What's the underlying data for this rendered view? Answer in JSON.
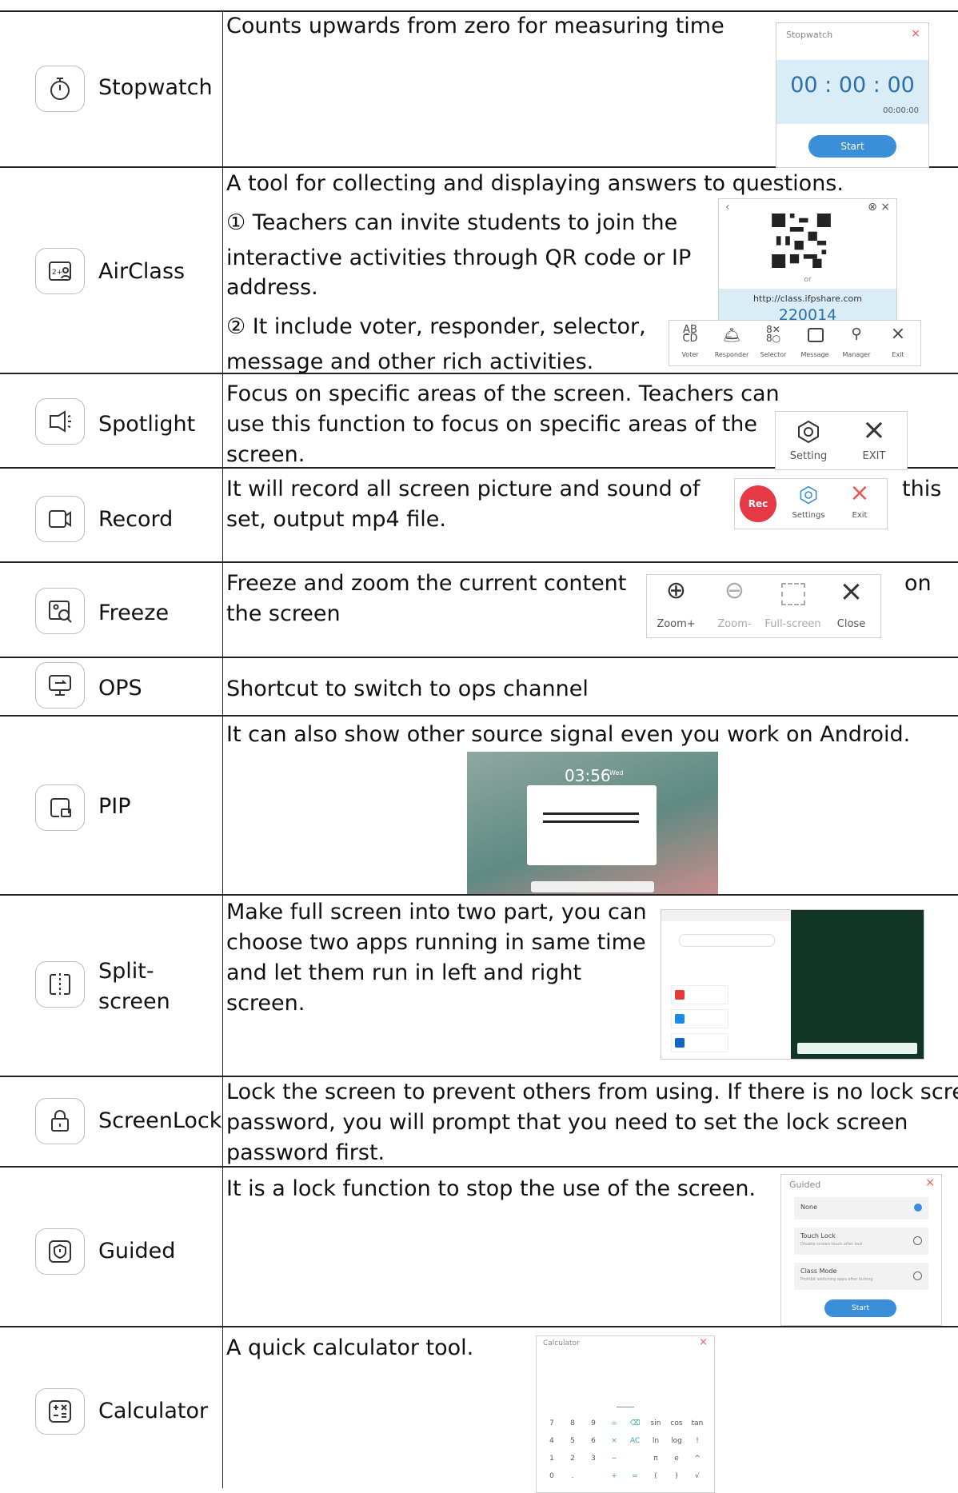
{
  "rows": [
    {
      "name": "Stopwatch",
      "icon": "stopwatch-icon",
      "desc": [
        "Counts upwards from zero for measuring time"
      ]
    },
    {
      "name": "AirClass",
      "icon": "airclass-icon",
      "desc": [
        "A tool for collecting and displaying answers to questions.",
        "① Teachers can invite students to join the",
        "interactive activities through QR code or IP",
        "address.",
        "② It include voter, responder, selector,",
        "message and other rich activities."
      ]
    },
    {
      "name": "Spotlight",
      "icon": "spotlight-icon",
      "desc": [
        "Focus on specific areas of the screen. Teachers can",
        "use this function to focus on specific areas of the",
        "screen."
      ]
    },
    {
      "name": "Record",
      "icon": "record-icon",
      "desc": [
        "It will record all screen picture and sound of",
        "set, output mp4 file.",
        "this"
      ]
    },
    {
      "name": "Freeze",
      "icon": "freeze-icon",
      "desc": [
        "Freeze and zoom the current content",
        "the screen",
        "on"
      ]
    },
    {
      "name": "OPS",
      "icon": "ops-icon",
      "desc": [
        "Shortcut to switch to ops channel"
      ]
    },
    {
      "name": "PIP",
      "icon": "pip-icon",
      "desc": [
        "It can also show other source signal even you work on Android."
      ]
    },
    {
      "name": "Split-screen",
      "name_lines": [
        "Split-",
        "screen"
      ],
      "icon": "split-screen-icon",
      "desc": [
        "Make full screen into two part, you can",
        "choose two apps running in same time",
        "and let them run in left and right",
        "screen."
      ]
    },
    {
      "name": "ScreenLock",
      "icon": "lock-icon",
      "desc": [
        "Lock the screen to prevent others from using. If there is no lock screen",
        "password, you will prompt that you need to set the lock screen",
        "password first."
      ]
    },
    {
      "name": "Guided",
      "icon": "shield-icon",
      "desc": [
        "It is a lock function to stop the use of the screen."
      ]
    },
    {
      "name": "Calculator",
      "icon": "calculator-icon",
      "desc": [
        "A quick calculator tool."
      ]
    }
  ],
  "stopwatch": {
    "title": "Stopwatch",
    "time": "00 : 00 : 00",
    "sub": "00:00:00",
    "start": "Start"
  },
  "airclass": {
    "url": "http://class.ifpshare.com",
    "code": "220014",
    "or": "or",
    "tools": [
      "Voter",
      "Responder",
      "Selector",
      "Message",
      "Manager",
      "Exit"
    ]
  },
  "spotlight": {
    "setting": "Setting",
    "exit": "EXIT"
  },
  "record": {
    "rec": "Rec",
    "settings": "Settings",
    "exit": "Exit"
  },
  "freeze": {
    "tools": [
      "Zoom+",
      "Zoom-",
      "Full-screen",
      "Close"
    ]
  },
  "pip": {
    "time": "03:56",
    "day": "Wed"
  },
  "guided": {
    "title": "Guided",
    "options": [
      {
        "label": "None",
        "sub": ""
      },
      {
        "label": "Touch Lock",
        "sub": "Disable screen touch after lock"
      },
      {
        "label": "Class Mode",
        "sub": "Prohibit switching apps after locking"
      }
    ],
    "start": "Start"
  },
  "calculator": {
    "title": "Calculator",
    "keys": [
      [
        "7",
        "8",
        "9",
        "÷",
        "⌫",
        "sin",
        "cos",
        "tan"
      ],
      [
        "4",
        "5",
        "6",
        "×",
        "AC",
        "ln",
        "log",
        "!"
      ],
      [
        "1",
        "2",
        "3",
        "−",
        "",
        "π",
        "e",
        "^"
      ],
      [
        "0",
        ".",
        "",
        "+",
        "=",
        "(",
        ")",
        "√"
      ]
    ]
  },
  "colors": {
    "accent": "#3a8fd8",
    "rec": "#e53945",
    "screen_bg": "#d9edf7"
  }
}
